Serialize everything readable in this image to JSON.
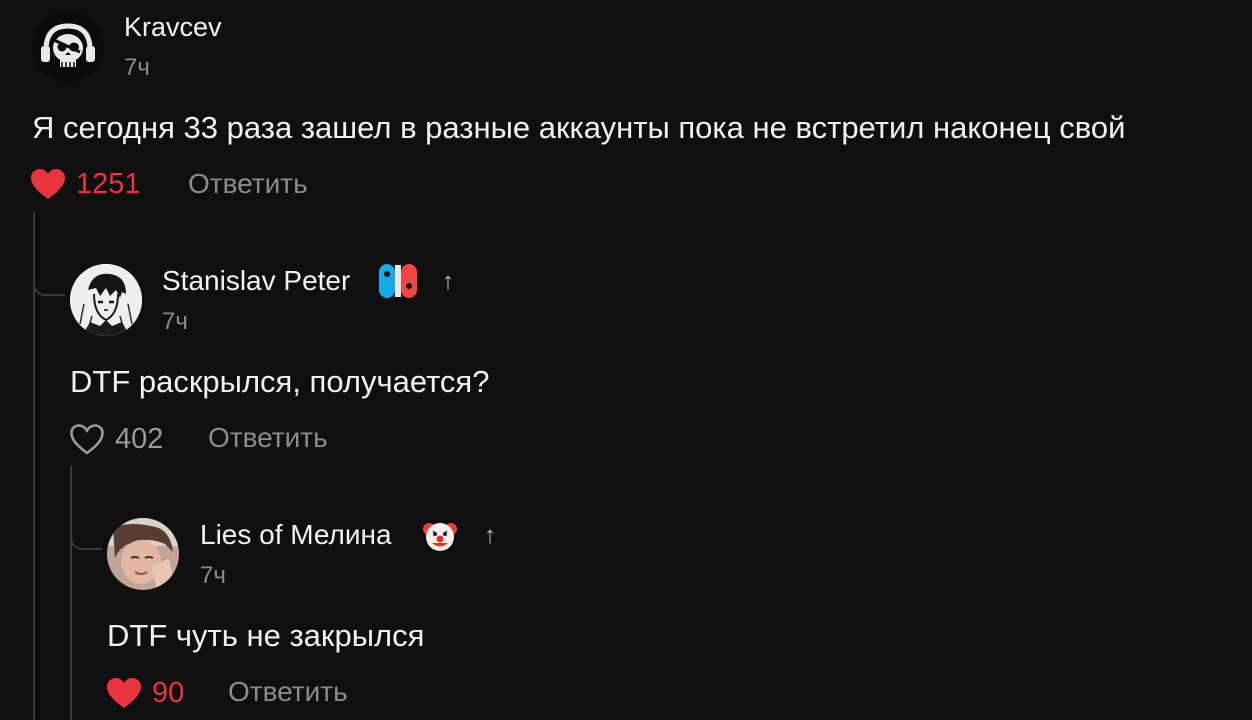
{
  "colors": {
    "background": "#0f0f10",
    "like_active": "#e8353f",
    "thread_line": "#3a3a3a"
  },
  "comments": [
    {
      "author": "Kravcev",
      "time": "7ч",
      "text": "Я сегодня 33 раза зашел в разные аккаунты пока не встретил наконец свой",
      "likes": "1251",
      "liked": true,
      "reply_label": "Ответить",
      "avatar_icon": "skull-pirate-headphones-icon"
    },
    {
      "author": "Stanislav Peter",
      "author_badge_icon": "nintendo-switch-icon",
      "time": "7ч",
      "text": "DTF раскрылся, получается?",
      "likes": "402",
      "liked": false,
      "reply_label": "Ответить",
      "avatar_icon": "sketch-portrait-avatar",
      "parent_arrow": "↑"
    },
    {
      "author": "Lies of Мелина",
      "author_badge_icon": "clown-face-emoji-icon",
      "time": "7ч",
      "text": "DTF чуть не закрылся",
      "likes": "90",
      "liked": true,
      "reply_label": "Ответить",
      "avatar_icon": "photo-avatar",
      "parent_arrow": "↑"
    }
  ]
}
